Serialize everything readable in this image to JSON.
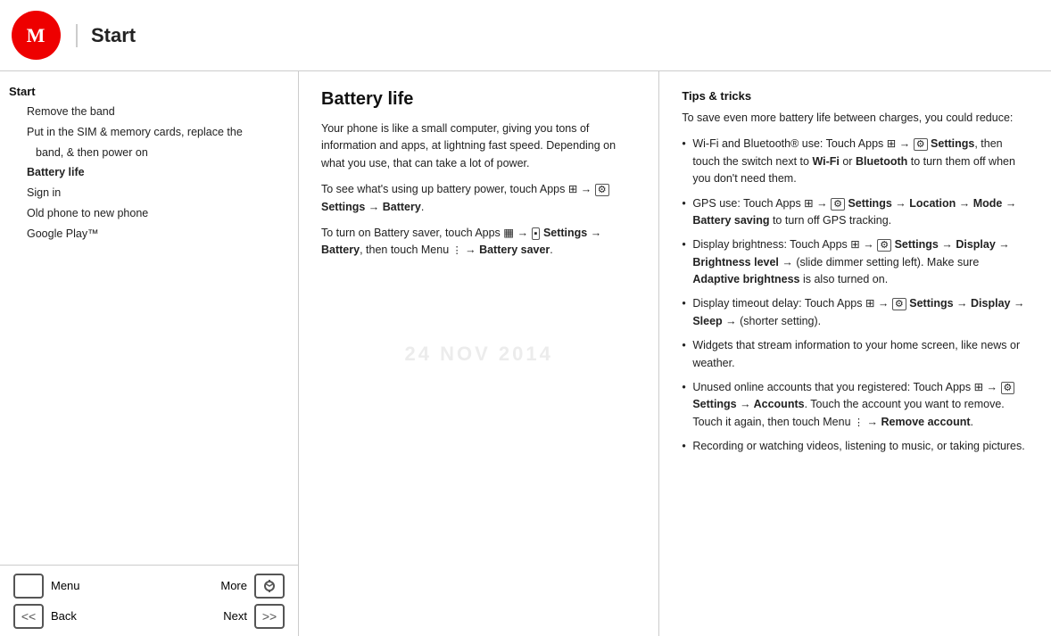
{
  "header": {
    "title": "Start"
  },
  "sidebar": {
    "nav_items": [
      {
        "label": "Start",
        "type": "section-title"
      },
      {
        "label": "Remove the band",
        "type": "indent"
      },
      {
        "label": "Put in the SIM & memory cards, replace the",
        "type": "indent"
      },
      {
        "label": "band, & then power on",
        "type": "indent2"
      },
      {
        "label": "Battery life",
        "type": "indent"
      },
      {
        "label": "Sign in",
        "type": "indent"
      },
      {
        "label": "Old phone to new phone",
        "type": "indent"
      },
      {
        "label": "Google Play™",
        "type": "indent"
      }
    ]
  },
  "battery_section": {
    "title": "Battery life",
    "para1": "Your phone is like a small computer, giving you tons of information and apps, at lightning fast speed. Depending on what you use, that can take a lot of power.",
    "para2_prefix": "To see what's using up battery power, touch Apps ",
    "para2_suffix": " Settings → Battery.",
    "para3_prefix": "To turn on Battery saver, touch Apps ",
    "para3_suffix": " Settings → Battery, then touch Menu  → Battery saver."
  },
  "tips_section": {
    "title": "Tips & tricks",
    "intro": "To save even more battery life between charges, you could reduce:",
    "items": [
      "Wi-Fi and Bluetooth® use: Touch Apps → Settings, then touch the switch next to Wi-Fi or Bluetooth to turn them off when you don't need them.",
      "GPS use: Touch Apps → Settings → Location → Mode → Battery saving to turn off GPS tracking.",
      "Display brightness: Touch Apps → Settings → Display → Brightness level → (slide dimmer setting left). Make sure Adaptive brightness is also turned on.",
      "Display timeout delay: Touch Apps → Settings → Display → Sleep → (shorter setting).",
      "Widgets that stream information to your home screen, like news or weather.",
      "Unused online accounts that you registered: Touch Apps → Settings → Accounts. Touch the account you want to remove. Touch it again, then touch Menu → Remove account.",
      "Recording or watching videos, listening to music, or taking pictures."
    ]
  },
  "watermark": {
    "date": "24 NOV 2014"
  },
  "bottom_nav": {
    "menu_label": "Menu",
    "more_label": "More",
    "back_label": "Back",
    "next_label": "Next"
  }
}
